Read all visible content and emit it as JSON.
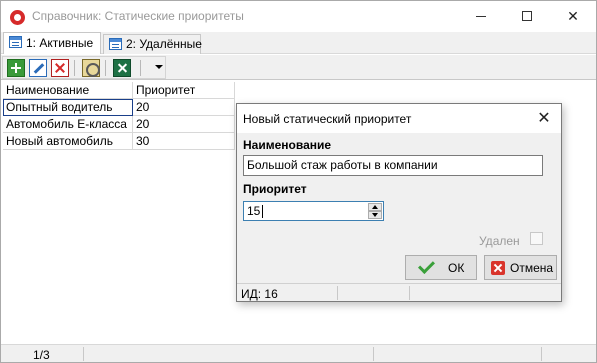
{
  "window": {
    "title": "Справочник: Статические приоритеты"
  },
  "tabs": [
    {
      "label": "1: Активные",
      "active": true
    },
    {
      "label": "2: Удалённые",
      "active": false
    }
  ],
  "toolbar": {
    "buttons": [
      "add-icon",
      "edit-icon",
      "delete-icon",
      "properties-icon",
      "excel-icon",
      "dropdown-arrow-icon"
    ]
  },
  "list": {
    "columns": [
      "Наименование",
      "Приоритет"
    ],
    "rows": [
      {
        "name": "Опытный водитель",
        "priority": "20"
      },
      {
        "name": "Автомобиль Е-класса",
        "priority": "20"
      },
      {
        "name": "Новый автомобиль",
        "priority": "30"
      }
    ]
  },
  "statusbar": {
    "position": "1/3"
  },
  "dialog": {
    "title": "Новый статический приоритет",
    "name_label": "Наименование",
    "name_value": "Большой стаж работы в компании",
    "priority_label": "Приоритет",
    "priority_value": "15",
    "deleted_label": "Удален",
    "deleted_checked": false,
    "ok_label": "ОК",
    "cancel_label": "Отмена",
    "id_text": "ИД: 16"
  },
  "colors": {
    "app_icon": "#d62a2a",
    "ok_check": "#3aa03a",
    "cancel_x": "#d9342b",
    "focus_border": "#3c7fb1"
  }
}
